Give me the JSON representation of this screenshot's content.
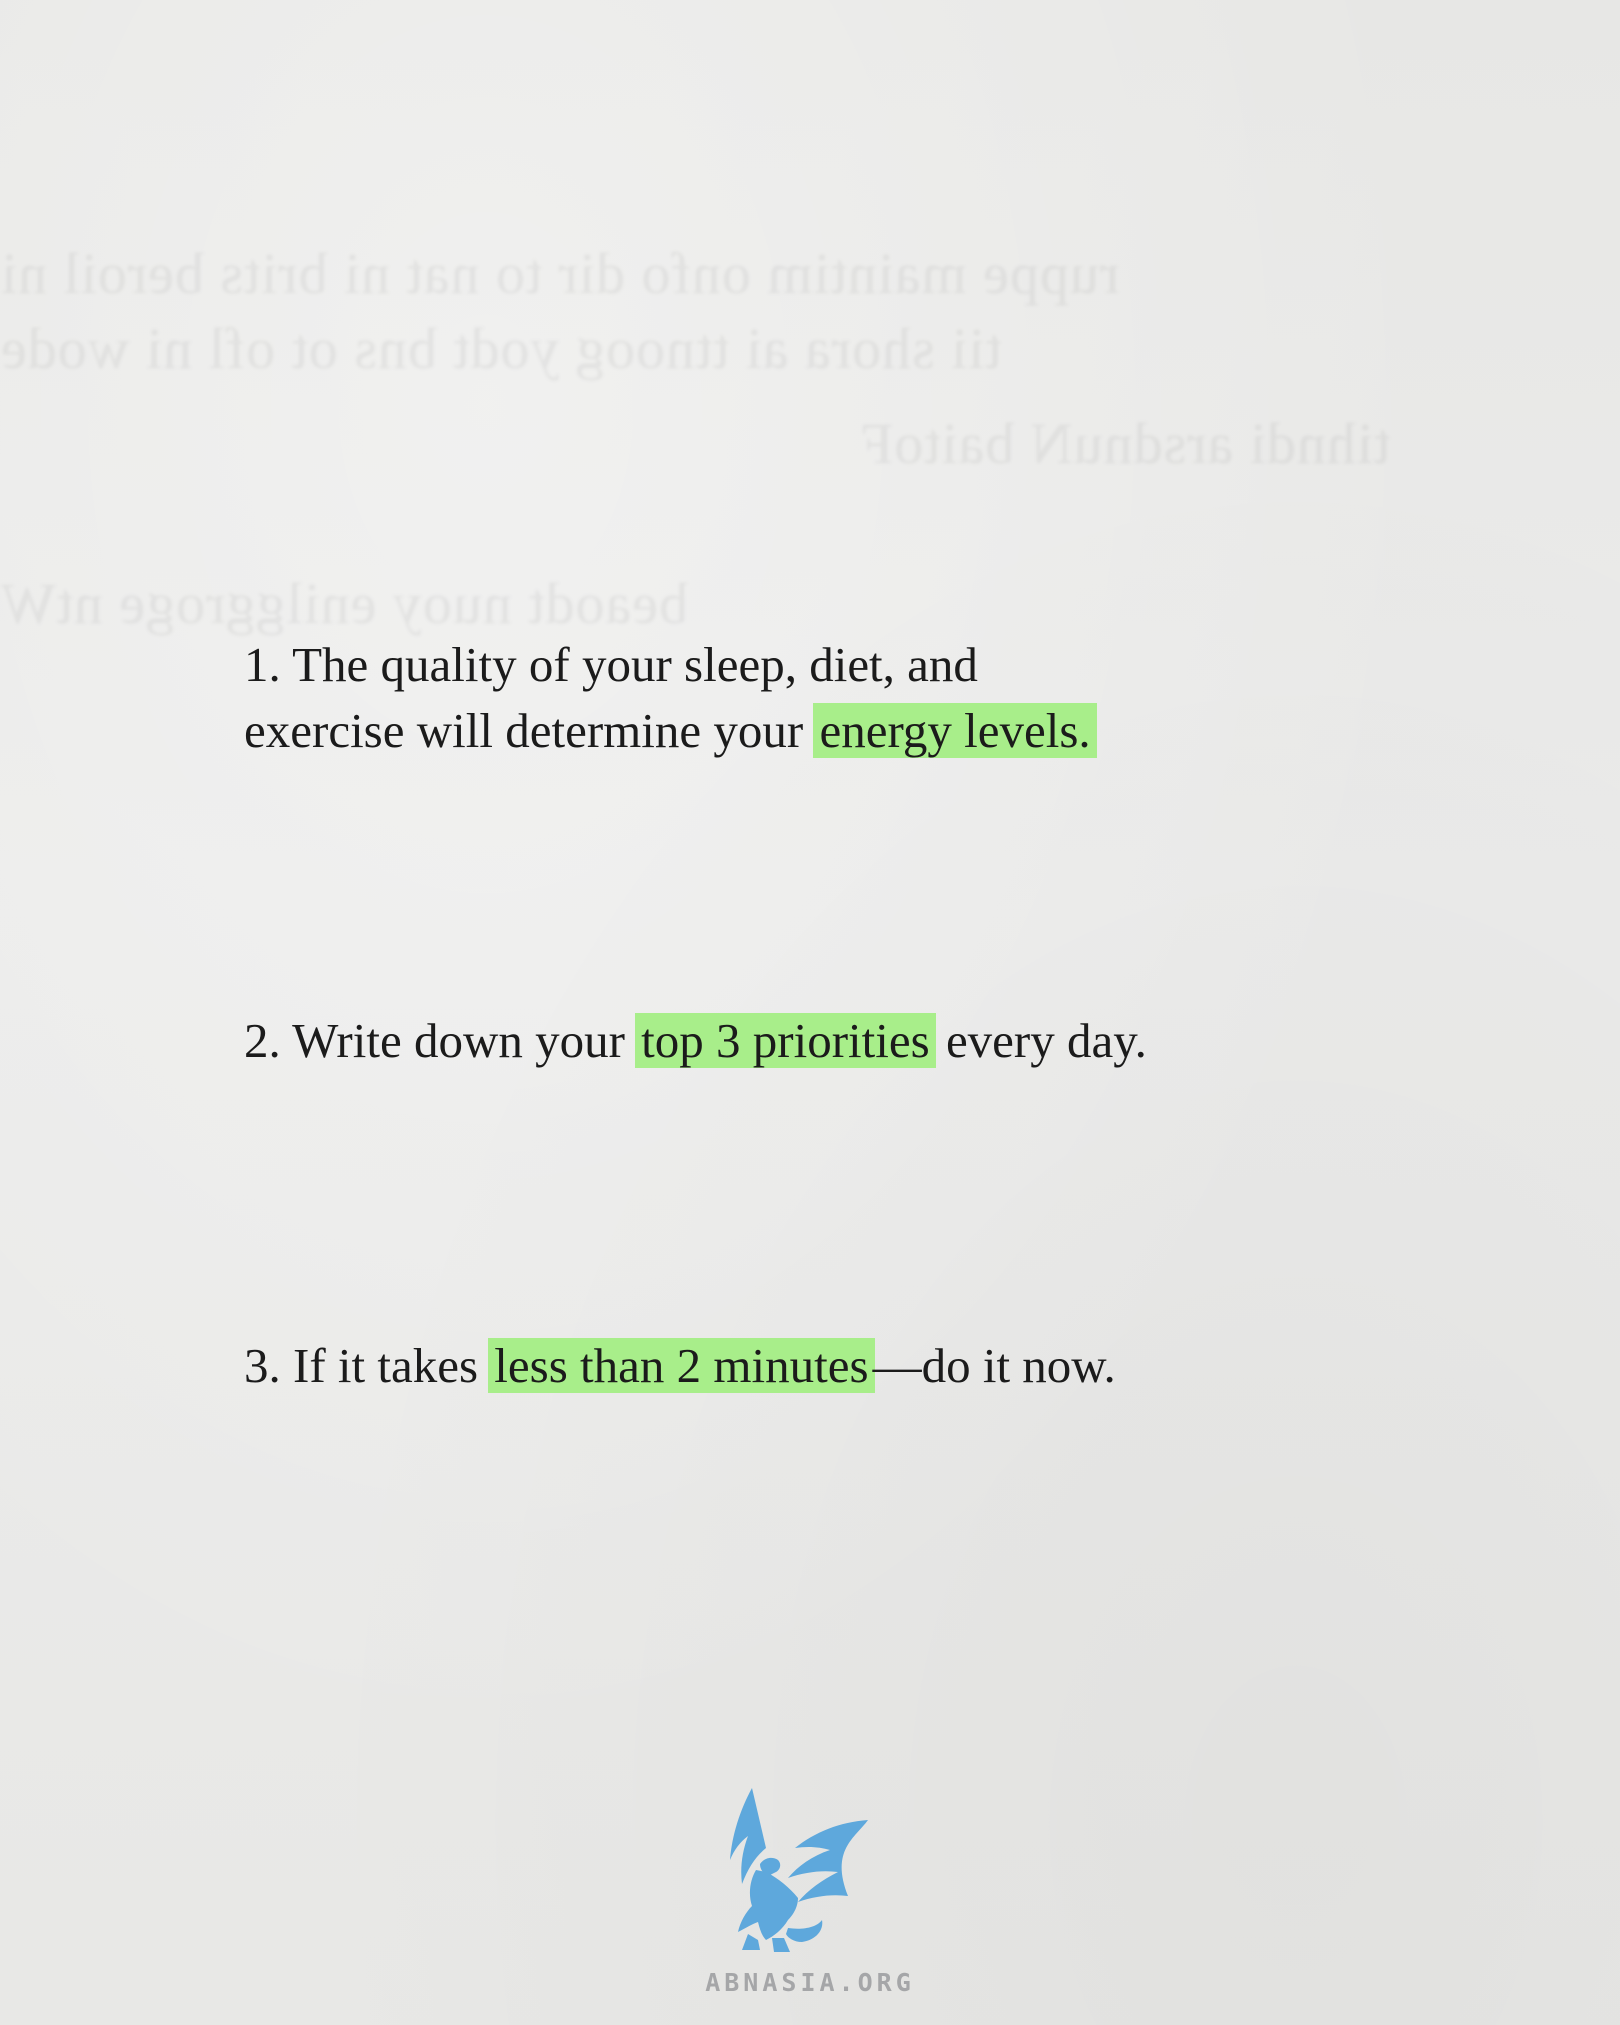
{
  "items": [
    {
      "lines": [
        {
          "before": "1. The quality of your sleep, diet, and",
          "highlight": "",
          "after": ""
        },
        {
          "before": "exercise will determine your ",
          "highlight": "energy levels.",
          "after": ""
        }
      ]
    },
    {
      "lines": [
        {
          "before": "2. Write down your ",
          "highlight": "top 3 priorities",
          "after": " every day."
        }
      ]
    },
    {
      "lines": [
        {
          "before": "3. If it takes ",
          "highlight": "less than 2 minutes",
          "after": "—do it now."
        }
      ]
    }
  ],
  "highlight_color": "#a8ee8a",
  "logo": {
    "icon": "griffin-icon",
    "text": "ABNASIA.ORG",
    "color": "#5ea8dc"
  }
}
